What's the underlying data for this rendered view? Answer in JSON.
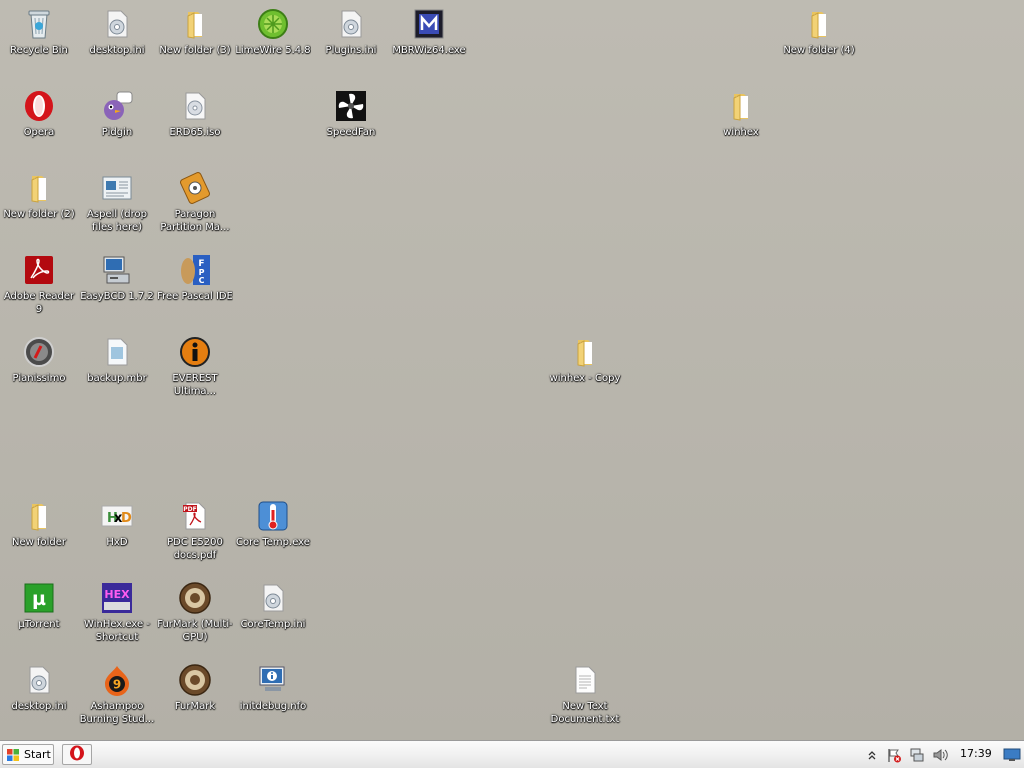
{
  "desktop": {
    "icons": {
      "recycle_bin": "Recycle Bin",
      "desktop_ini_1": "desktop.ini",
      "new_folder_3": "New folder (3)",
      "limewire": "LimeWire 5.4.8",
      "plugins_ini": "Plugins.ini",
      "mbrwiz64": "MBRWiz64.exe",
      "new_folder_4": "New folder (4)",
      "opera": "Opera",
      "pidgin": "Pidgin",
      "erd65": "ERD65.iso",
      "speedfan": "SpeedFan",
      "winhex_folder": "winhex",
      "new_folder_2": "New folder (2)",
      "aspell": "Aspell (drop files here)",
      "paragon": "Paragon Partition Ma...",
      "adobe_reader": "Adobe Reader 9",
      "easybcd": "EasyBCD 1.7.2",
      "free_pascal": "Free Pascal IDE",
      "pianissimo": "Pianissimo",
      "backup_mbr": "backup.mbr",
      "everest": "EVEREST Ultima...",
      "winhex_copy": "winhex - Copy",
      "new_folder": "New folder",
      "hxd": "HxD",
      "pdc_docs": "PDC E5200 docs.pdf",
      "coretemp_exe": "Core Temp.exe",
      "utorrent": "µTorrent",
      "winhex_shortcut": "WinHex.exe - Shortcut",
      "furmark_multi": "FurMark (Multi-GPU)",
      "coretemp_ini": "CoreTemp.ini",
      "desktop_ini_2": "desktop.ini",
      "ashampoo": "Ashampoo Burning Stud...",
      "furmark": "FurMark",
      "initdebug": "initdebug.nfo",
      "new_text_doc": "New Text Document.txt"
    }
  },
  "taskbar": {
    "start_label": "Start",
    "clock": "17:39"
  },
  "colors": {
    "desktop_bg": "#bbb8af",
    "label_text": "#ffffff",
    "folder": "#f2d276",
    "opera_red": "#d4141b"
  }
}
